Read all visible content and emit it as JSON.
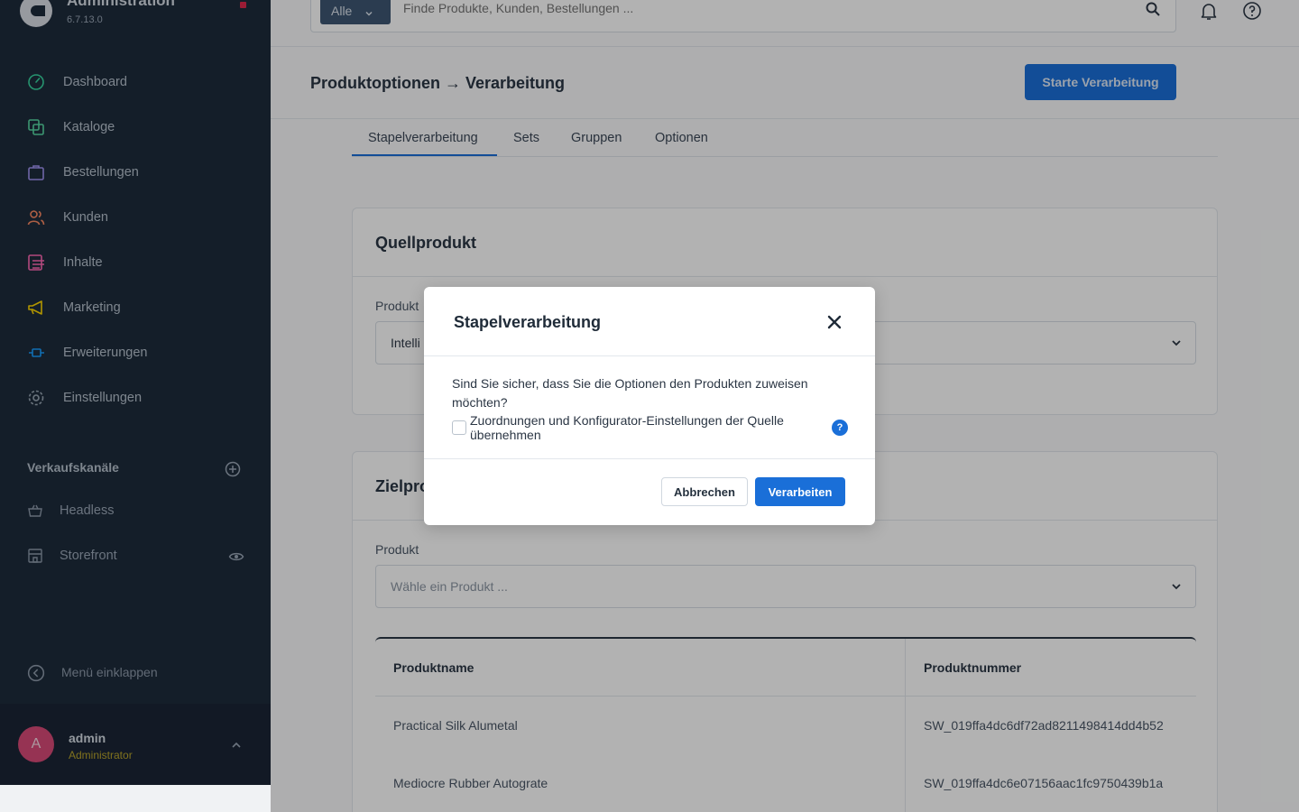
{
  "app": {
    "title": "Administration",
    "version": "6.7.13.0"
  },
  "sidebar": {
    "items": [
      {
        "label": "Dashboard",
        "icon": "dashboard-icon",
        "color": "#37d5a0"
      },
      {
        "label": "Kataloge",
        "icon": "catalog-icon",
        "color": "#57d9a3"
      },
      {
        "label": "Bestellungen",
        "icon": "bag-icon",
        "color": "#a092f0"
      },
      {
        "label": "Kunden",
        "icon": "users-icon",
        "color": "#f88962"
      },
      {
        "label": "Inhalte",
        "icon": "content-icon",
        "color": "#ff68b4"
      },
      {
        "label": "Marketing",
        "icon": "megaphone-icon",
        "color": "#ffd700"
      },
      {
        "label": "Erweiterungen",
        "icon": "plugin-icon",
        "color": "#189eff"
      },
      {
        "label": "Einstellungen",
        "icon": "gear-icon",
        "color": "#9aa8b5"
      }
    ],
    "sales_channels_title": "Verkaufskanäle",
    "channels": [
      {
        "label": "Headless",
        "icon": "basket-icon"
      },
      {
        "label": "Storefront",
        "icon": "storefront-icon"
      }
    ],
    "collapse_label": "Menü einklappen",
    "user": {
      "initial": "A",
      "name": "admin",
      "role": "Administrator"
    }
  },
  "topbar": {
    "search_type": "Alle",
    "search_placeholder": "Finde Produkte, Kunden, Bestellungen ..."
  },
  "page": {
    "title": "Produktoptionen → Verarbeitung",
    "primary_button": "Starte Verarbeitung",
    "tabs": [
      "Stapelverarbeitung",
      "Sets",
      "Gruppen",
      "Optionen"
    ],
    "active_tab": "Stapelverarbeitung"
  },
  "source_card": {
    "title": "Quellprodukt",
    "field_label": "Produkt",
    "value": "Intelli"
  },
  "target_card": {
    "title": "Zielpro",
    "field_label": "Produkt",
    "placeholder": "Wähle ein Produkt ...",
    "table": {
      "columns": [
        "Produktname",
        "Produktnummer"
      ],
      "rows": [
        [
          "Practical Silk Alumetal",
          "SW_019ffa4dc6df72ad8211498414dd4b52"
        ],
        [
          "Mediocre Rubber Autograte",
          "SW_019ffa4dc6e07156aac1fc9750439b1a"
        ]
      ]
    }
  },
  "modal": {
    "title": "Stapelverarbeitung",
    "message": "Sind Sie sicher, dass Sie die Optionen den Produkten zuweisen möchten?",
    "checkbox_label": "Zuordnungen und Konfigurator-Einstellungen der Quelle übernehmen",
    "checkbox_checked": false,
    "info_glyph": "?",
    "cancel_label": "Abbrechen",
    "confirm_label": "Verarbeiten"
  },
  "colors": {
    "sidebar_bg": "#1e2b3c",
    "accent": "#1a6fd8",
    "user_role": "#b8a42b",
    "avatar": "#d74a78"
  }
}
